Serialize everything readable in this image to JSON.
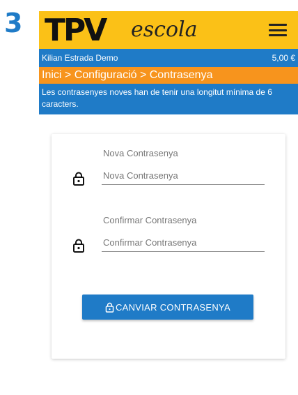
{
  "step": "3",
  "header": {
    "logo_main": "TPV",
    "logo_sub": "escola",
    "menu_icon": "hamburger-menu-icon"
  },
  "user_bar": {
    "name": "Kilian Estrada Demo",
    "balance": "5,00 €"
  },
  "breadcrumb": "Inici > Configuració > Contrasenya",
  "info": "Les contrasenyes noves han de tenir una longitut mínima de 6 caracters.",
  "form": {
    "new_password": {
      "label": "Nova Contrasenya",
      "placeholder": "Nova Contrasenya",
      "value": "",
      "icon": "lock-icon"
    },
    "confirm_password": {
      "label": "Confirmar Contrasenya",
      "placeholder": "Confirmar Contrasenya",
      "value": "",
      "icon": "lock-icon"
    },
    "submit_label": "CANVIAR CONTRASENYA",
    "submit_icon": "lock-icon"
  },
  "colors": {
    "primary": "#1f7bc7",
    "accent": "#f7941d",
    "header": "#fbc117"
  }
}
